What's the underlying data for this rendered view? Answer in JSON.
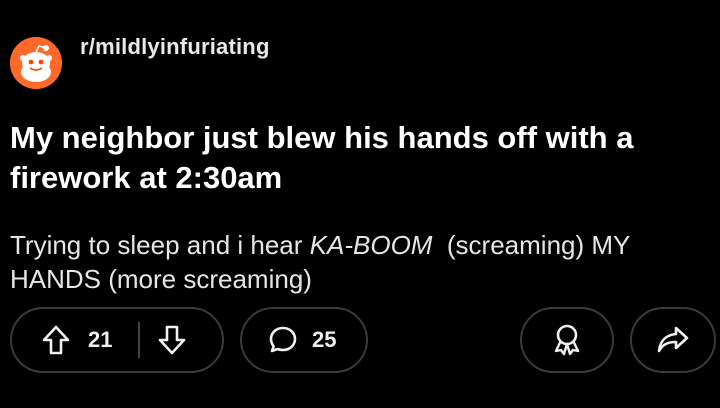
{
  "post": {
    "subreddit": "r/mildlyinfuriating",
    "title": "My neighbor just blew his hands off with a firework at 2:30am",
    "body": {
      "part1": "Trying to sleep and i hear ",
      "part2_italic": "KA-BOOM",
      "part3": "  (screaming) MY HANDS (more screaming)"
    }
  },
  "actions": {
    "vote_count": "21",
    "comment_count": "25"
  },
  "icons": {
    "avatar": "reddit-snoo-avatar-icon",
    "upvote": "arrow-up-outline-icon",
    "downvote": "arrow-down-outline-icon",
    "comment": "speech-bubble-icon",
    "award": "award-ribbon-icon",
    "share": "share-arrow-icon"
  },
  "colors": {
    "background": "#000000",
    "avatar_orange": "#ff6a2b",
    "pill_border": "#3a3a3a"
  }
}
